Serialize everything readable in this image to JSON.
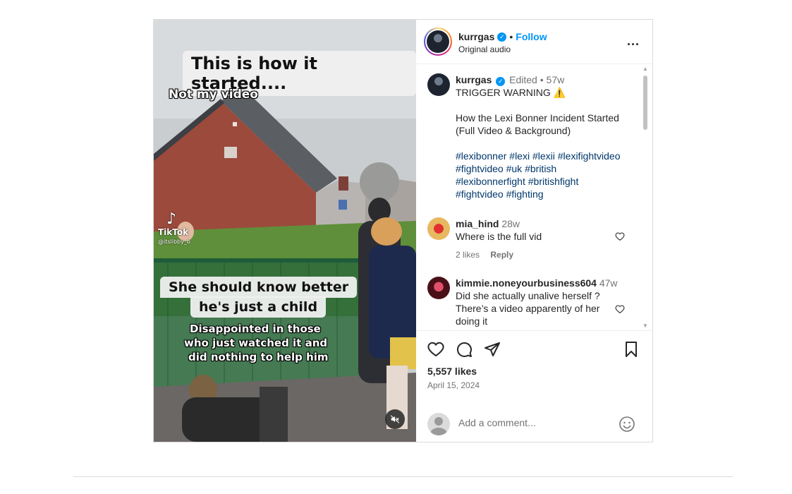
{
  "media": {
    "caption_top": "This is how it started....",
    "caption_not_my_video": "Not my video",
    "tiktok_brand": "TikTok",
    "tiktok_user": "@itslibby_b",
    "caption_middle_line1": "She should know better",
    "caption_middle_line2": "he's just a child",
    "caption_bottom_line1": "Disappointed in those",
    "caption_bottom_line2": "who just watched it and",
    "caption_bottom_line3": "did nothing to help him",
    "mute_icon": "speaker-muted-icon"
  },
  "header": {
    "username": "kurrgas",
    "separator": "•",
    "follow_label": "Follow",
    "audio": "Original audio",
    "more_label": "..."
  },
  "caption": {
    "username": "kurrgas",
    "edited": "Edited",
    "separator": "•",
    "age": "57w",
    "line1": "TRIGGER WARNING",
    "warning_emoji": "⚠️",
    "line2": "How the Lexi Bonner Incident Started",
    "line3": "(Full Video & Background)",
    "tags": [
      "#lexibonner",
      "#lexi",
      "#lexii",
      "#lexifightvideo",
      "#fightvideo",
      "#uk",
      "#british",
      "#lexibonnerfight",
      "#britishfight",
      "#fightvideo",
      "#fighting"
    ]
  },
  "comments": [
    {
      "username": "mia_hind",
      "age": "28w",
      "text": "Where is the full vid",
      "likes": "2 likes",
      "reply": "Reply"
    },
    {
      "username": "kimmie.noneyourbusiness604",
      "age": "47w",
      "text_line1": "Did she actually unalive herself ?",
      "text_line2": "There’s a video apparently of her",
      "text_line3": "doing it"
    }
  ],
  "footer": {
    "likes": "5,557 likes",
    "date": "April 15, 2024",
    "comment_placeholder": "Add a comment..."
  },
  "colors": {
    "accent": "#0095f6",
    "hashtag": "#00376b",
    "muted_text": "#737373",
    "border": "#dbdbdb"
  }
}
